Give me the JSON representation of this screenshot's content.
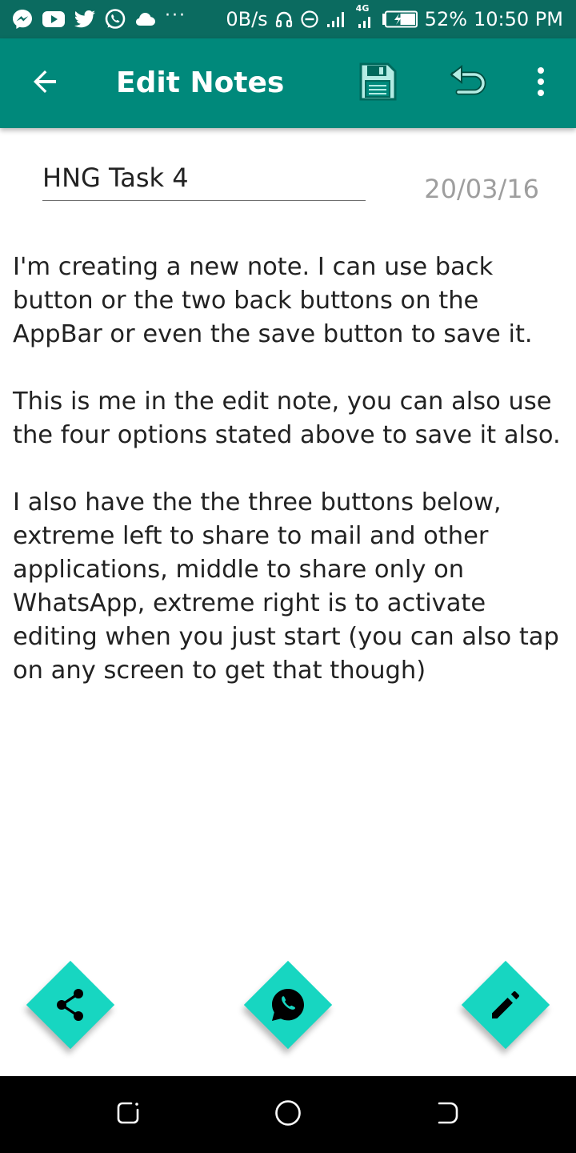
{
  "status_bar": {
    "net_speed": "0B/s",
    "network_type": "4G",
    "battery": "52%",
    "time": "10:50 PM",
    "left_icons": [
      "messenger-icon",
      "youtube-icon",
      "twitter-icon",
      "whatsapp-icon",
      "cloud-icon",
      "more-notifications-icon"
    ]
  },
  "app_bar": {
    "title": "Edit Notes",
    "icons": [
      "back-arrow-icon",
      "save-icon",
      "undo-icon",
      "overflow-menu-icon"
    ]
  },
  "note": {
    "title": "HNG Task 4",
    "date": "20/03/16",
    "paragraphs": [
      "I'm creating a new note. I can use back button or the two back buttons on the AppBar or even the save button to save it.",
      "This is me in the edit note, you can also use the four options stated above to save it also.",
      "I also have the the three buttons below, extreme left to share to mail and other applications, middle to share only on WhatsApp, extreme right is to activate editing when you just start (you can also tap on any screen to get that though)"
    ]
  },
  "bottom_actions": {
    "icons": [
      "share-icon",
      "whatsapp-icon",
      "pencil-icon"
    ],
    "accent_color": "#17d6c1"
  },
  "nav_bar": {
    "icons": [
      "recent-apps-icon",
      "home-icon",
      "back-icon"
    ]
  },
  "colors": {
    "status_bar": "#0b6b60",
    "app_bar": "#00897b",
    "text": "#222222",
    "date": "#9e9e9e",
    "fab": "#17d6c1",
    "nav_bar": "#000000"
  }
}
